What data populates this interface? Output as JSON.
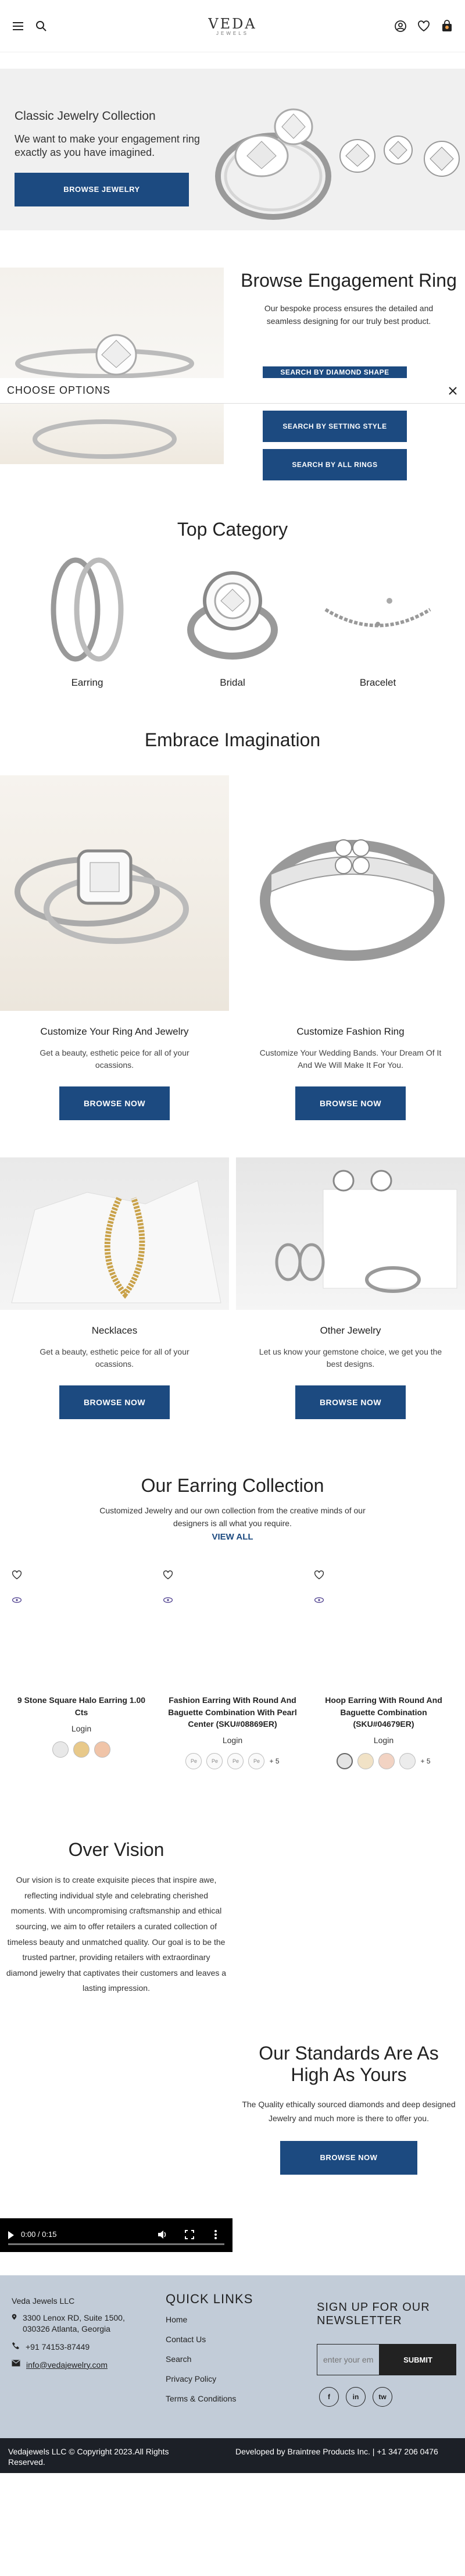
{
  "header": {
    "logo_name": "VEDA",
    "logo_sub": "JEWELS"
  },
  "hero": {
    "title": "Classic Jewelry Collection",
    "text": "We want to make your engagement ring exactly as you have imagined.",
    "button": "BROWSE JEWELRY"
  },
  "engagement": {
    "title": "Browse Engagement Ring",
    "text": "Our bespoke process ensures the detailed and seamless designing for our truly best product.",
    "btn_diamond": "SEARCH BY DIAMOND SHAPE",
    "btn_setting": "SEARCH BY SETTING STYLE",
    "btn_all": "SEARCH BY ALL RINGS",
    "choose_options": "CHOOSE OPTIONS"
  },
  "top_category": {
    "title": "Top Category",
    "items": [
      {
        "label": "Earring"
      },
      {
        "label": "Bridal"
      },
      {
        "label": "Bracelet"
      }
    ]
  },
  "embrace": {
    "title": "Embrace Imagination",
    "cards": [
      {
        "title": "Customize Your Ring And Jewelry",
        "text": "Get a beauty, esthetic peice for all of your ocassions.",
        "button": "BROWSE NOW"
      },
      {
        "title": "Customize Fashion Ring",
        "text": "Customize Your Wedding Bands. Your Dream Of It And We Will Make It For You.",
        "button": "BROWSE NOW"
      },
      {
        "title": "Necklaces",
        "text": "Get a beauty, esthetic peice for all of your ocassions.",
        "button": "BROWSE NOW"
      },
      {
        "title": "Other Jewelry",
        "text": "Let us know your gemstone choice, we get you the best designs.",
        "button": "BROWSE NOW"
      }
    ]
  },
  "earrings": {
    "title": "Our Earring Collection",
    "text": "Customized Jewelry and our own collection from the creative minds of our designers is all what you require.",
    "view_all": "VIEW ALL",
    "products": [
      {
        "title": "9 Stone Square Halo Earring 1.00 Cts",
        "login": "Login",
        "swatches": [
          "",
          "",
          ""
        ],
        "more": ""
      },
      {
        "title": "Fashion Earring With Round And Baguette Combination With Pearl Center (SKU#08869ER)",
        "login": "Login",
        "swatches": [
          "Pe",
          "Pe",
          "Pe",
          "Pe"
        ],
        "more": "+ 5"
      },
      {
        "title": "Hoop Earring With Round And Baguette Combination (SKU#04679ER)",
        "login": "Login",
        "swatches": [
          "",
          "",
          "",
          ""
        ],
        "more": "+ 5"
      }
    ]
  },
  "vision": {
    "title": "Over Vision",
    "text": "Our vision is to create exquisite pieces that inspire awe, reflecting individual style and celebrating cherished moments. With uncompromising craftsmanship and ethical sourcing, we aim to offer retailers a curated collection of timeless beauty and unmatched quality. Our goal is to be the trusted partner, providing retailers with extraordinary diamond jewelry that captivates their customers and leaves a lasting impression."
  },
  "standards": {
    "title": "Our Standards Are As High As Yours",
    "text": "The Quality ethically sourced diamonds and deep designed Jewelry and much more is there to offer you.",
    "button": "BROWSE NOW",
    "video_time": "0:00 / 0:15"
  },
  "footer": {
    "logo_alt": "Veda Jewels LLC",
    "address": "3300 Lenox RD, Suite 1500, 030326 Atlanta, Georgia",
    "phone": "+91 74153-87449",
    "email": "info@vedajewelry.com",
    "quick_links_title": "QUICK LINKS",
    "links": [
      "Home",
      "Contact Us",
      "Search",
      "Privacy Policy",
      "Terms & Conditions"
    ],
    "newsletter_title": "SIGN UP FOR OUR NEWSLETTER",
    "email_placeholder": "enter your email",
    "submit": "SUBMIT",
    "socials": [
      "f",
      "in",
      "tw"
    ],
    "copyright": "Vedajewels LLC © Copyright 2023.All Rights Reserved.",
    "developed_by": "Developed by Braintree Products Inc. | +1 347 206 0476"
  }
}
